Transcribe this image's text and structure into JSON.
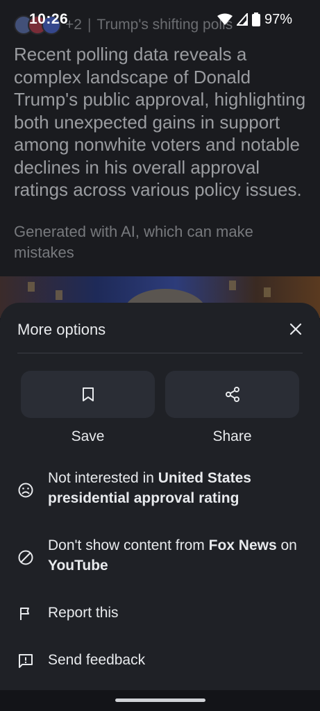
{
  "status_bar": {
    "time": "10:26",
    "battery": "97%"
  },
  "article": {
    "source_count": "+2",
    "source_title": "Trump's shifting polls",
    "summary": "Recent polling data reveals a complex landscape of Donald Trump's public approval, highlighting both unexpected gains in support among nonwhite voters and notable declines in his overall approval ratings across various policy issues.",
    "ai_note": "Generated with AI, which can make mistakes"
  },
  "sheet": {
    "title": "More options",
    "actions": [
      {
        "label": "Save",
        "icon": "bookmark-icon"
      },
      {
        "label": "Share",
        "icon": "share-icon"
      }
    ],
    "menu": [
      {
        "icon": "sad-face-icon",
        "prefix": "Not interested in ",
        "bold": "United States presidential approval rating",
        "middle": "",
        "bold2": "",
        "suffix": ""
      },
      {
        "icon": "block-icon",
        "prefix": "Don't show content from ",
        "bold": "Fox News",
        "middle": " on ",
        "bold2": "YouTube",
        "suffix": ""
      },
      {
        "icon": "flag-icon",
        "prefix": "Report this",
        "bold": "",
        "middle": "",
        "bold2": "",
        "suffix": ""
      },
      {
        "icon": "feedback-icon",
        "prefix": "Send feedback",
        "bold": "",
        "middle": "",
        "bold2": "",
        "suffix": ""
      }
    ]
  },
  "colors": {
    "sheet_bg": "#1f2126",
    "button_bg": "#2a2d35",
    "text": "#e8eaed"
  }
}
